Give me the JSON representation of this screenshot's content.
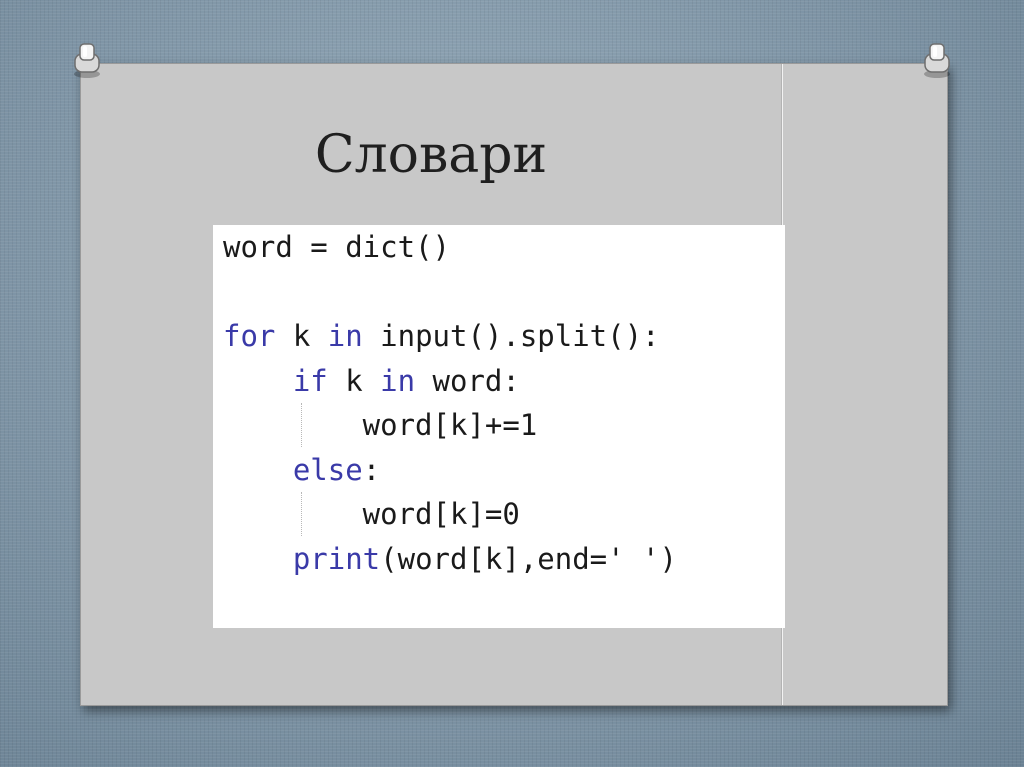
{
  "slide": {
    "title": "Словари"
  },
  "code": {
    "lines": [
      [
        {
          "text": "word = dict()",
          "kind": "plain"
        }
      ],
      [
        {
          "text": "",
          "kind": "plain"
        }
      ],
      [
        {
          "text": "for",
          "kind": "kw"
        },
        {
          "text": " k ",
          "kind": "plain"
        },
        {
          "text": "in",
          "kind": "kw"
        },
        {
          "text": " input().split():",
          "kind": "plain"
        }
      ],
      [
        {
          "text": "    ",
          "kind": "plain"
        },
        {
          "text": "if",
          "kind": "kw"
        },
        {
          "text": " k ",
          "kind": "plain"
        },
        {
          "text": "in",
          "kind": "kw"
        },
        {
          "text": " word:",
          "kind": "plain"
        }
      ],
      [
        {
          "text": "        word[k]+=1",
          "kind": "plain"
        }
      ],
      [
        {
          "text": "    ",
          "kind": "plain"
        },
        {
          "text": "else",
          "kind": "kw"
        },
        {
          "text": ":",
          "kind": "plain"
        }
      ],
      [
        {
          "text": "        word[k]=0",
          "kind": "plain"
        }
      ],
      [
        {
          "text": "    ",
          "kind": "plain"
        },
        {
          "text": "print",
          "kind": "fn"
        },
        {
          "text": "(word[k],end=' ')",
          "kind": "plain"
        }
      ]
    ]
  },
  "colors": {
    "keyword": "#3a3aa8",
    "text": "#1a1a1a",
    "slide_background": "#c8c8c8",
    "desktop_background": "#7f95a6"
  },
  "icons": {
    "left_pin": "pushpin-icon",
    "right_pin": "pushpin-icon"
  }
}
